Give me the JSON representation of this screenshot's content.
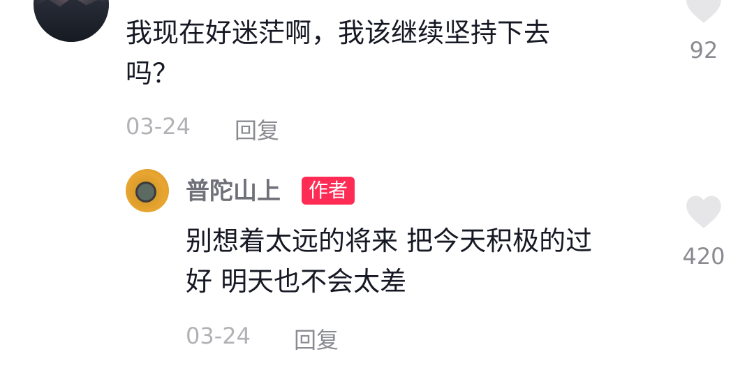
{
  "top_comment": {
    "text_line1": "我现在好迷茫啊，我该继续坚持下去",
    "text_line2": "吗？",
    "date": "03-24",
    "reply_label": "回复",
    "like_count": "92"
  },
  "reply": {
    "author": "普陀山上",
    "author_badge": "作者",
    "text_line1": "别想着太远的将来 把今天积极的过",
    "text_line2": "好 明天也不会太差",
    "date": "03-24",
    "reply_label": "回复",
    "like_count": "420"
  },
  "colors": {
    "badge": "#fe2c55",
    "text": "#161823",
    "meta": "#8a8b91",
    "like_icon": "#e6e6e8"
  }
}
